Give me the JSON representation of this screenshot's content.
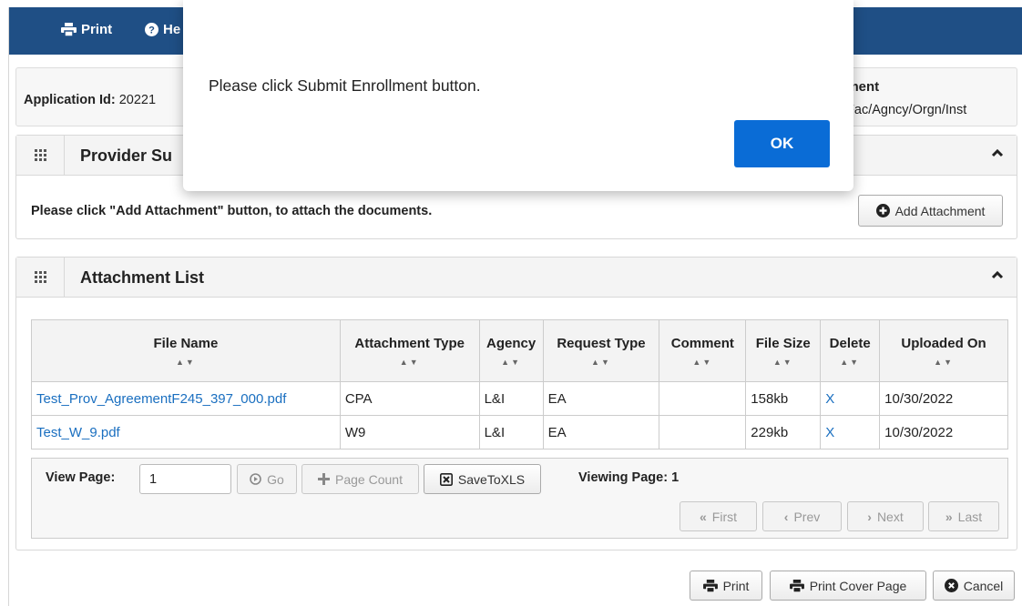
{
  "topbar": {
    "print": "Print",
    "help": "He"
  },
  "app": {
    "id_label": "Application Id:",
    "id_value": "20221",
    "right_title": "llment",
    "right_sub": ": Fac/Agncy/Orgn/Inst"
  },
  "provider_panel": {
    "title": "Provider Su",
    "instruction": "Please click \"Add Attachment\" button, to attach the documents.",
    "add_button": "Add Attachment"
  },
  "attachment_panel": {
    "title": "Attachment List"
  },
  "table": {
    "columns": [
      "File Name",
      "Attachment Type",
      "Agency",
      "Request Type",
      "Comment",
      "File Size",
      "Delete",
      "Uploaded On"
    ],
    "rows": [
      {
        "file": "Test_Prov_AgreementF245_397_000.pdf",
        "type": "CPA",
        "agency": "L&I",
        "request": "EA",
        "comment": "",
        "size": "158kb",
        "delete": "X",
        "uploaded": "10/30/2022"
      },
      {
        "file": "Test_W_9.pdf",
        "type": "W9",
        "agency": "L&I",
        "request": "EA",
        "comment": "",
        "size": "229kb",
        "delete": "X",
        "uploaded": "10/30/2022"
      }
    ]
  },
  "pager": {
    "view_page_label": "View Page:",
    "view_page_value": "1",
    "go": "Go",
    "page_count": "Page Count",
    "save_xls": "SaveToXLS",
    "viewing": "Viewing Page: 1",
    "first": "First",
    "prev": "Prev",
    "next": "Next",
    "last": "Last"
  },
  "footer": {
    "print": "Print",
    "print_cover": "Print Cover Page",
    "cancel": "Cancel"
  },
  "modal": {
    "message": "Please click Submit Enrollment button.",
    "ok": "OK"
  },
  "colors": {
    "topbar": "#1f4f85",
    "link": "#1a6fc0",
    "ok_button": "#0a6cd6"
  }
}
